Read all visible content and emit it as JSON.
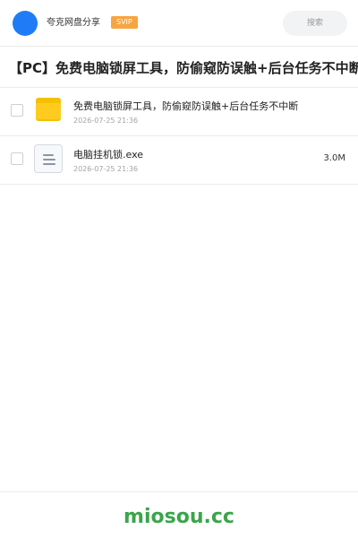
{
  "header": {
    "username": "夸克网盘分享",
    "badge": "SVIP",
    "search_placeholder": "搜索",
    "brand_color": "#1f7cf6",
    "badge_color": "#f7a541"
  },
  "share": {
    "title": "【PC】免费电脑锁屏工具，防偷窥防误触+后台任务不中断"
  },
  "files": [
    {
      "icon": "folder-icon",
      "name": "免费电脑锁屏工具，防偷窥防误触+后台任务不中断",
      "date": "2026-07-25 21:36",
      "size": ""
    },
    {
      "icon": "file-icon",
      "name": "电脑挂机锁.exe",
      "date": "2026-07-25 21:36",
      "size": "3.0M"
    }
  ],
  "footer": {
    "brand": "miosou.cc",
    "brand_color": "#3aa54a"
  }
}
